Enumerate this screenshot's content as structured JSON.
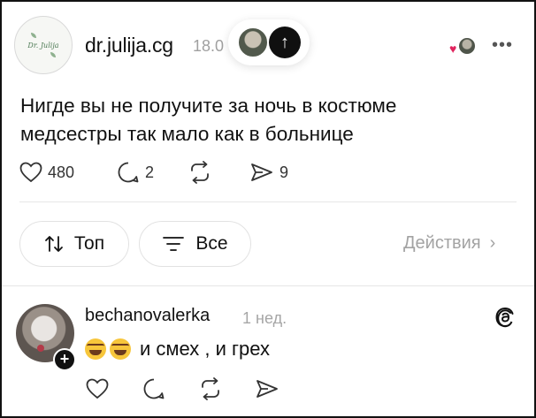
{
  "post": {
    "avatar_logo_text": "Dr. Julija",
    "username": "dr.julija.cg",
    "timestamp": "18.0",
    "text_line1": "Нигде вы не получите за ночь в костюме",
    "text_line2": "медсестры так мало как в больнице",
    "likes": "480",
    "replies": "2",
    "shares": "9"
  },
  "sort": {
    "top_label": "Топ",
    "all_label": "Все",
    "activity_label": "Действия"
  },
  "comment": {
    "username": "bechanovalerka",
    "timestamp": "1 нед.",
    "text": "и смех , и грех"
  },
  "icons": {
    "heart": "heart-icon",
    "reply": "comment-icon",
    "repost": "repost-icon",
    "share": "share-icon",
    "more": "more-icon",
    "threads": "threads-icon"
  },
  "colors": {
    "text": "#111111",
    "muted": "#a0a0a0",
    "border": "#e2e2e2",
    "accent_dark": "#101010",
    "heart_red": "#e0245e"
  }
}
